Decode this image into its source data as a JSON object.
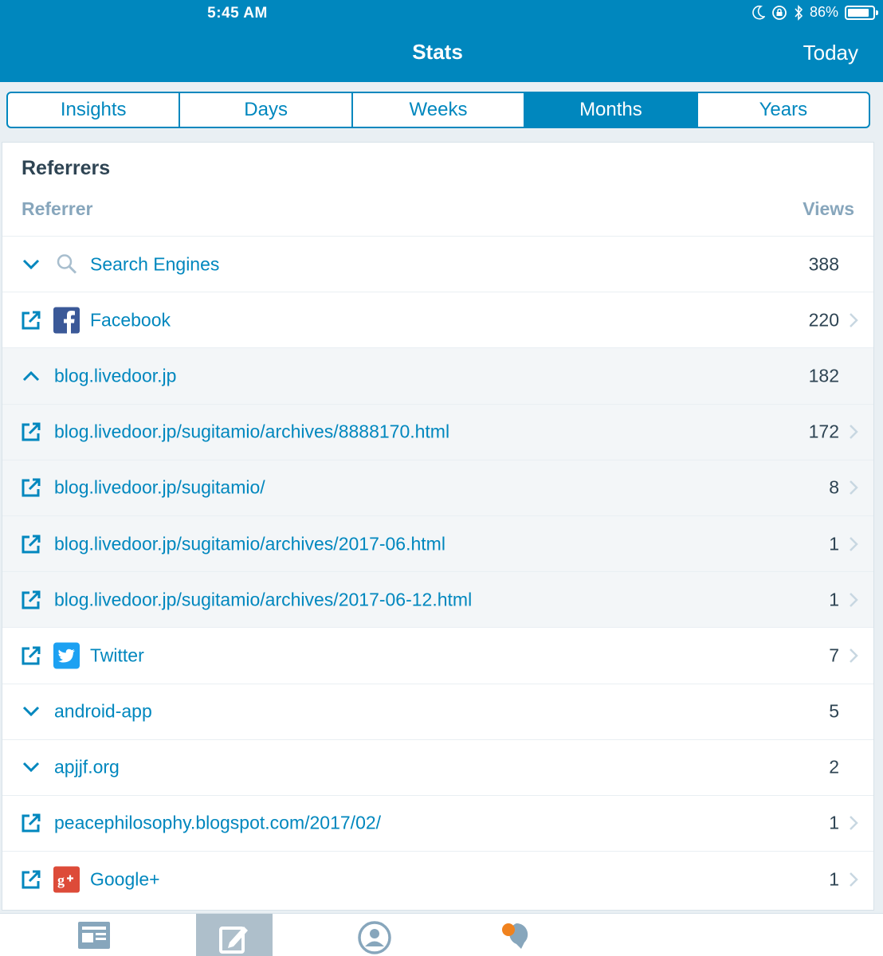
{
  "status_bar": {
    "time": "5:45 AM",
    "battery_text": "86%",
    "battery_level": 0.86
  },
  "header": {
    "title": "Stats",
    "right_button": "Today"
  },
  "segments": [
    {
      "label": "Insights",
      "active": false
    },
    {
      "label": "Days",
      "active": false
    },
    {
      "label": "Weeks",
      "active": false
    },
    {
      "label": "Months",
      "active": true
    },
    {
      "label": "Years",
      "active": false
    }
  ],
  "card": {
    "title": "Referrers",
    "col_left": "Referrer",
    "col_right": "Views"
  },
  "rows": [
    {
      "label": "Search Engines",
      "value": "388",
      "action_icon": "chevron-down-icon",
      "logo": "search-icon",
      "chevron": false,
      "child": false
    },
    {
      "label": "Facebook",
      "value": "220",
      "action_icon": "external-link-icon",
      "logo": "facebook-icon",
      "chevron": true,
      "child": false
    },
    {
      "label": "blog.livedoor.jp",
      "value": "182",
      "action_icon": "chevron-up-icon",
      "logo": null,
      "chevron": false,
      "child": true
    },
    {
      "label": "blog.livedoor.jp/sugitamio/archives/8888170.html",
      "value": "172",
      "action_icon": "external-link-icon",
      "logo": null,
      "chevron": true,
      "child": true
    },
    {
      "label": "blog.livedoor.jp/sugitamio/",
      "value": "8",
      "action_icon": "external-link-icon",
      "logo": null,
      "chevron": true,
      "child": true
    },
    {
      "label": "blog.livedoor.jp/sugitamio/archives/2017-06.html",
      "value": "1",
      "action_icon": "external-link-icon",
      "logo": null,
      "chevron": true,
      "child": true
    },
    {
      "label": "blog.livedoor.jp/sugitamio/archives/2017-06-12.html",
      "value": "1",
      "action_icon": "external-link-icon",
      "logo": null,
      "chevron": true,
      "child": true
    },
    {
      "label": "Twitter",
      "value": "7",
      "action_icon": "external-link-icon",
      "logo": "twitter-icon",
      "chevron": true,
      "child": false
    },
    {
      "label": "android-app",
      "value": "5",
      "action_icon": "chevron-down-icon",
      "logo": null,
      "chevron": false,
      "child": false
    },
    {
      "label": "apjjf.org",
      "value": "2",
      "action_icon": "chevron-down-icon",
      "logo": null,
      "chevron": false,
      "child": false
    },
    {
      "label": "peacephilosophy.blogspot.com/2017/02/",
      "value": "1",
      "action_icon": "external-link-icon",
      "logo": null,
      "chevron": true,
      "child": false
    },
    {
      "label": "Google+",
      "value": "1",
      "action_icon": "external-link-icon",
      "logo": "google-plus-icon",
      "chevron": true,
      "child": false
    }
  ],
  "tabbar": [
    {
      "icon": "reader-icon",
      "active": false
    },
    {
      "icon": "write-post-icon",
      "active": true
    },
    {
      "icon": "me-icon",
      "active": false
    },
    {
      "icon": "notifications-icon",
      "active": false
    }
  ],
  "colors": {
    "accent": "#0087be",
    "text_dark": "#2e4453",
    "muted": "#87a6bc",
    "facebook": "#3b5998",
    "twitter": "#1da1f2",
    "google_plus": "#dd4b39"
  }
}
